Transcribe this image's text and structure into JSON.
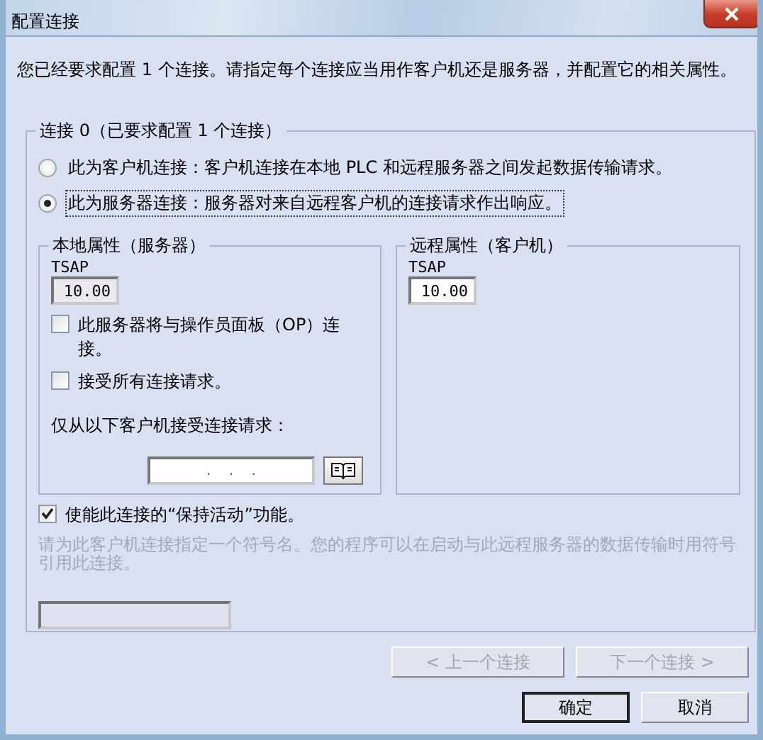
{
  "window": {
    "title": "配置连接"
  },
  "intro": "您已经要求配置 1 个连接。请指定每个连接应当用作客户机还是服务器，并配置它的相关属性。",
  "connection": {
    "title": "连接 0（已要求配置 1 个连接）",
    "modes": [
      {
        "label": "此为客户机连接：客户机连接在本地 PLC 和远程服务器之间发起数据传输请求。",
        "selected": false
      },
      {
        "label": "此为服务器连接：服务器对来自远程客户机的连接请求作出响应。",
        "selected": true
      }
    ],
    "local": {
      "title": "本地属性（服务器）",
      "tsap_label": "TSAP",
      "tsap": "10.00",
      "tsap_disabled": true,
      "options": [
        {
          "label": "此服务器将与操作员面板（OP）连接。",
          "checked": false
        },
        {
          "label": "接受所有连接请求。",
          "checked": false
        }
      ],
      "accept_label": "仅从以下客户机接受连接请求：",
      "ip": ".    .    ."
    },
    "remote": {
      "title": "远程属性（客户机）",
      "tsap_label": "TSAP",
      "tsap": "10.00",
      "tsap_disabled": false
    },
    "keep_alive": {
      "label": "使能此连接的“保持活动”功能。",
      "checked": true
    },
    "symbol_hint": {
      "text": "请为此客户机连接指定一个符号名。您的程序可以在启动与此远程服务器的数据传输时用符号引用此连接。",
      "disabled": true
    },
    "symbol_field": {
      "disabled": true
    }
  },
  "nav_buttons": [
    {
      "label": "< 上一个连接",
      "disabled": true
    },
    {
      "label": "下一个连接 >",
      "disabled": true
    }
  ],
  "dialog_buttons": [
    {
      "label": "确定",
      "default": true
    },
    {
      "label": "取消",
      "default": false
    }
  ]
}
